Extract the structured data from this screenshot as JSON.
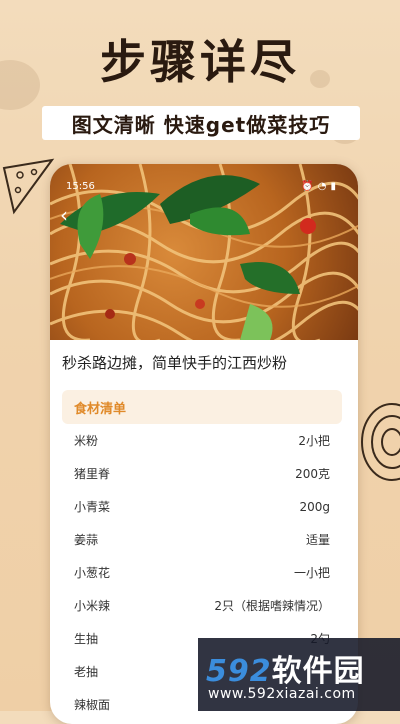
{
  "headline": "步骤详尽",
  "subheadline": "图文清晰 快速get做菜技巧",
  "status_bar": {
    "time": "15:56"
  },
  "recipe": {
    "title": "秒杀路边摊，简单快手的江西炒粉",
    "ingredients_header": "食材清单",
    "ingredients": [
      {
        "name": "米粉",
        "amount": "2小把"
      },
      {
        "name": "猪里脊",
        "amount": "200克"
      },
      {
        "name": "小青菜",
        "amount": "200g"
      },
      {
        "name": "姜蒜",
        "amount": "适量"
      },
      {
        "name": "小葱花",
        "amount": "一小把"
      },
      {
        "name": "小米辣",
        "amount": "2只（根据嗜辣情况）"
      },
      {
        "name": "生抽",
        "amount": "2勺"
      },
      {
        "name": "老抽",
        "amount": ""
      },
      {
        "name": "辣椒面",
        "amount": ""
      }
    ]
  },
  "watermark": {
    "brand_num": "592",
    "brand_cn": "软件园",
    "url": "www.592xiazai.com"
  },
  "colors": {
    "accent": "#e08a2a",
    "background": "#f0d3ad",
    "watermark_blue": "#3b8ddc"
  }
}
